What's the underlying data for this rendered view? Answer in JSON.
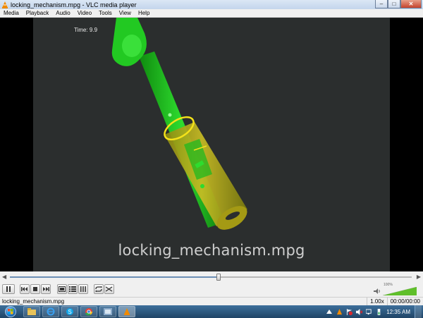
{
  "window": {
    "title": "locking_mechanism.mpg - VLC media player",
    "buttons": {
      "minimize": "–",
      "maximize": "□",
      "close": "✕"
    }
  },
  "menu": [
    "Media",
    "Playback",
    "Audio",
    "Video",
    "Tools",
    "View",
    "Help"
  ],
  "video": {
    "time_text": "Time: 9.9",
    "subtitle": "locking_mechanism.mpg",
    "colors": {
      "background": "#2b2e2e",
      "rod": "#1fc21f",
      "tube": "#b3a915"
    }
  },
  "seek": {
    "position_fraction": 0.52
  },
  "controls": {
    "buttons": [
      "pause-icon",
      "previous-icon",
      "stop-icon",
      "next-icon",
      "fullscreen-icon",
      "extended-settings-icon",
      "playlist-icon",
      "effects-icon",
      "loop-icon",
      "shuffle-icon"
    ],
    "volume_percent": "100%",
    "volume_level": 1.0
  },
  "status": {
    "filename": "locking_mechanism.mpg",
    "speed": "1.00x",
    "time": "00:00/00:00"
  },
  "taskbar": {
    "items": [
      "explorer-icon",
      "internet-explorer-icon",
      "skype-icon",
      "chrome-icon",
      "control-panel-icon",
      "vlc-icon"
    ],
    "clock": "12:35 AM"
  }
}
